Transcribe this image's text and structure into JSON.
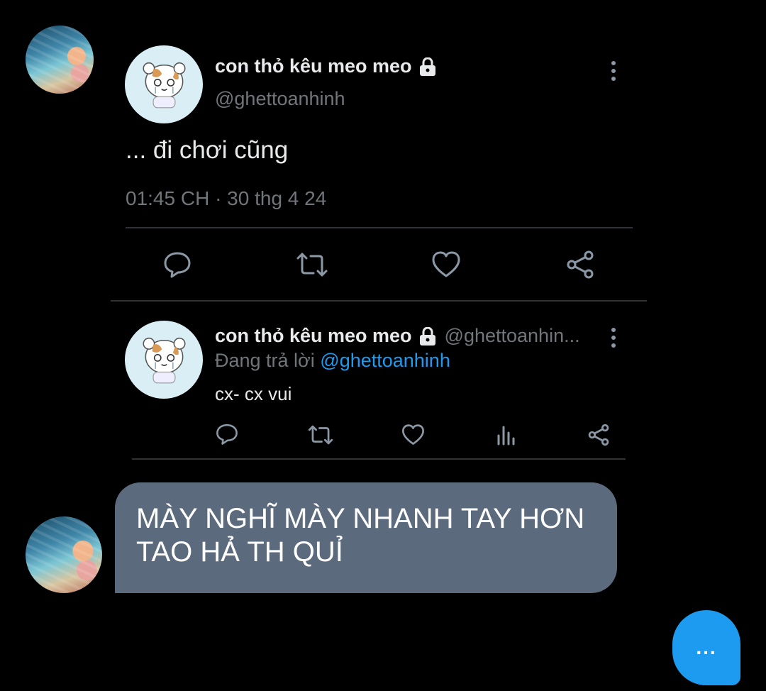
{
  "tweet": {
    "author_name": "con thỏ kêu meo meo",
    "author_handle": "@ghettoanhinh",
    "text": "... đi chơi cũng",
    "timestamp": "01:45 CH · 30 thg 4 24",
    "actions": [
      "reply-icon",
      "retweet-icon",
      "like-icon",
      "share-icon"
    ]
  },
  "reply": {
    "author_name": "con thỏ kêu meo meo",
    "author_handle": "@ghettoanhin...",
    "replying_prefix": "Đang trả lời",
    "replying_to": "@ghettoanhinh",
    "text": "cx- cx vui",
    "actions": [
      "reply-icon",
      "retweet-icon",
      "like-icon",
      "analytics-icon",
      "share-icon"
    ]
  },
  "message": {
    "text": "MÀY NGHĨ MÀY NHANH TAY HƠN TAO HẢ TH QUỈ"
  },
  "fab": {
    "label": "..."
  },
  "colors": {
    "background": "#000000",
    "bubble": "#5b6b7d",
    "accent": "#1d9bf0",
    "muted": "#71767b"
  }
}
